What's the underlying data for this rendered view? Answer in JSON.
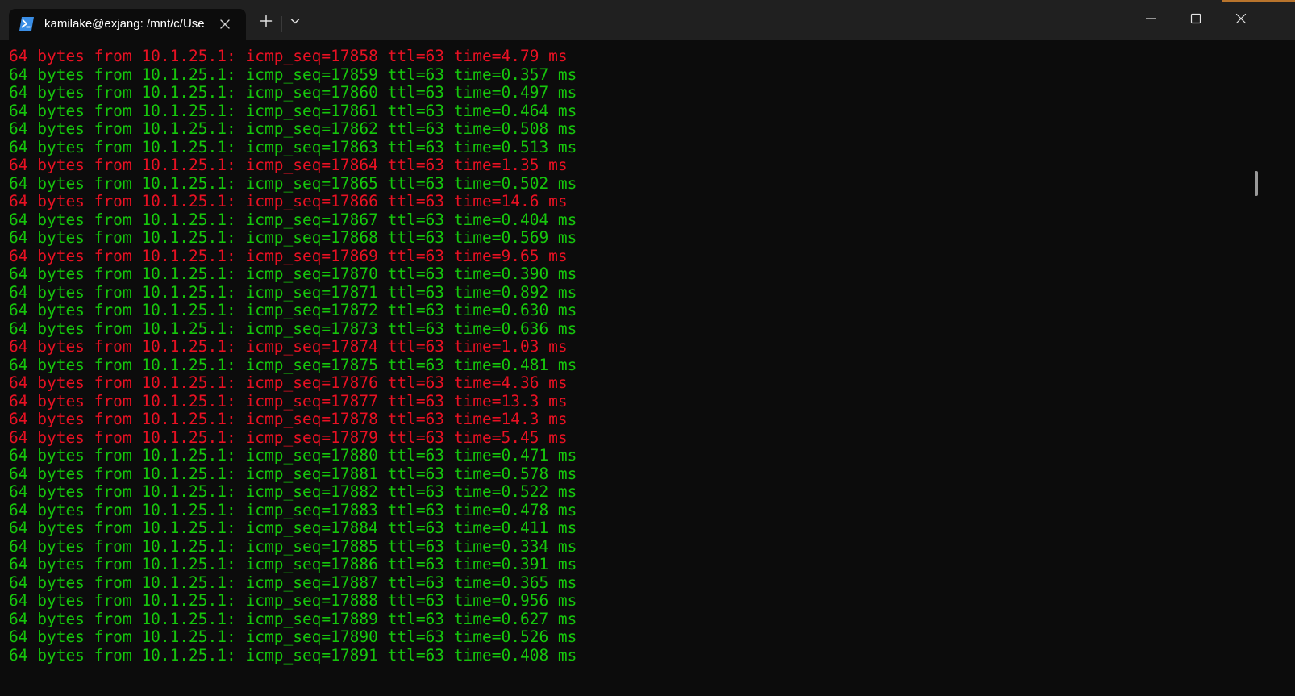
{
  "window": {
    "tab_title": "kamilake@exjang: /mnt/c/Use",
    "icons": {
      "tab": "powershell-icon",
      "tab_close": "close-icon",
      "new_tab": "plus-icon",
      "dropdown": "chevron-down-icon",
      "minimize": "minimize-icon",
      "maximize": "maximize-icon",
      "close": "close-icon"
    }
  },
  "colors": {
    "fast": "#16c60c",
    "slow": "#e81123",
    "background": "#0c0c0c",
    "titlebar": "#202020"
  },
  "terminal": {
    "lines": [
      {
        "text": "64 bytes from 10.1.25.1: icmp_seq=17858 ttl=63 time=4.79 ms",
        "status": "slow"
      },
      {
        "text": "64 bytes from 10.1.25.1: icmp_seq=17859 ttl=63 time=0.357 ms",
        "status": "fast"
      },
      {
        "text": "64 bytes from 10.1.25.1: icmp_seq=17860 ttl=63 time=0.497 ms",
        "status": "fast"
      },
      {
        "text": "64 bytes from 10.1.25.1: icmp_seq=17861 ttl=63 time=0.464 ms",
        "status": "fast"
      },
      {
        "text": "64 bytes from 10.1.25.1: icmp_seq=17862 ttl=63 time=0.508 ms",
        "status": "fast"
      },
      {
        "text": "64 bytes from 10.1.25.1: icmp_seq=17863 ttl=63 time=0.513 ms",
        "status": "fast"
      },
      {
        "text": "64 bytes from 10.1.25.1: icmp_seq=17864 ttl=63 time=1.35 ms",
        "status": "slow"
      },
      {
        "text": "64 bytes from 10.1.25.1: icmp_seq=17865 ttl=63 time=0.502 ms",
        "status": "fast"
      },
      {
        "text": "64 bytes from 10.1.25.1: icmp_seq=17866 ttl=63 time=14.6 ms",
        "status": "slow"
      },
      {
        "text": "64 bytes from 10.1.25.1: icmp_seq=17867 ttl=63 time=0.404 ms",
        "status": "fast"
      },
      {
        "text": "64 bytes from 10.1.25.1: icmp_seq=17868 ttl=63 time=0.569 ms",
        "status": "fast"
      },
      {
        "text": "64 bytes from 10.1.25.1: icmp_seq=17869 ttl=63 time=9.65 ms",
        "status": "slow"
      },
      {
        "text": "64 bytes from 10.1.25.1: icmp_seq=17870 ttl=63 time=0.390 ms",
        "status": "fast"
      },
      {
        "text": "64 bytes from 10.1.25.1: icmp_seq=17871 ttl=63 time=0.892 ms",
        "status": "fast"
      },
      {
        "text": "64 bytes from 10.1.25.1: icmp_seq=17872 ttl=63 time=0.630 ms",
        "status": "fast"
      },
      {
        "text": "64 bytes from 10.1.25.1: icmp_seq=17873 ttl=63 time=0.636 ms",
        "status": "fast"
      },
      {
        "text": "64 bytes from 10.1.25.1: icmp_seq=17874 ttl=63 time=1.03 ms",
        "status": "slow"
      },
      {
        "text": "64 bytes from 10.1.25.1: icmp_seq=17875 ttl=63 time=0.481 ms",
        "status": "fast"
      },
      {
        "text": "64 bytes from 10.1.25.1: icmp_seq=17876 ttl=63 time=4.36 ms",
        "status": "slow"
      },
      {
        "text": "64 bytes from 10.1.25.1: icmp_seq=17877 ttl=63 time=13.3 ms",
        "status": "slow"
      },
      {
        "text": "64 bytes from 10.1.25.1: icmp_seq=17878 ttl=63 time=14.3 ms",
        "status": "slow"
      },
      {
        "text": "64 bytes from 10.1.25.1: icmp_seq=17879 ttl=63 time=5.45 ms",
        "status": "slow"
      },
      {
        "text": "64 bytes from 10.1.25.1: icmp_seq=17880 ttl=63 time=0.471 ms",
        "status": "fast"
      },
      {
        "text": "64 bytes from 10.1.25.1: icmp_seq=17881 ttl=63 time=0.578 ms",
        "status": "fast"
      },
      {
        "text": "64 bytes from 10.1.25.1: icmp_seq=17882 ttl=63 time=0.522 ms",
        "status": "fast"
      },
      {
        "text": "64 bytes from 10.1.25.1: icmp_seq=17883 ttl=63 time=0.478 ms",
        "status": "fast"
      },
      {
        "text": "64 bytes from 10.1.25.1: icmp_seq=17884 ttl=63 time=0.411 ms",
        "status": "fast"
      },
      {
        "text": "64 bytes from 10.1.25.1: icmp_seq=17885 ttl=63 time=0.334 ms",
        "status": "fast"
      },
      {
        "text": "64 bytes from 10.1.25.1: icmp_seq=17886 ttl=63 time=0.391 ms",
        "status": "fast"
      },
      {
        "text": "64 bytes from 10.1.25.1: icmp_seq=17887 ttl=63 time=0.365 ms",
        "status": "fast"
      },
      {
        "text": "64 bytes from 10.1.25.1: icmp_seq=17888 ttl=63 time=0.956 ms",
        "status": "fast"
      },
      {
        "text": "64 bytes from 10.1.25.1: icmp_seq=17889 ttl=63 time=0.627 ms",
        "status": "fast"
      },
      {
        "text": "64 bytes from 10.1.25.1: icmp_seq=17890 ttl=63 time=0.526 ms",
        "status": "fast"
      },
      {
        "text": "64 bytes from 10.1.25.1: icmp_seq=17891 ttl=63 time=0.408 ms",
        "status": "fast"
      }
    ]
  }
}
